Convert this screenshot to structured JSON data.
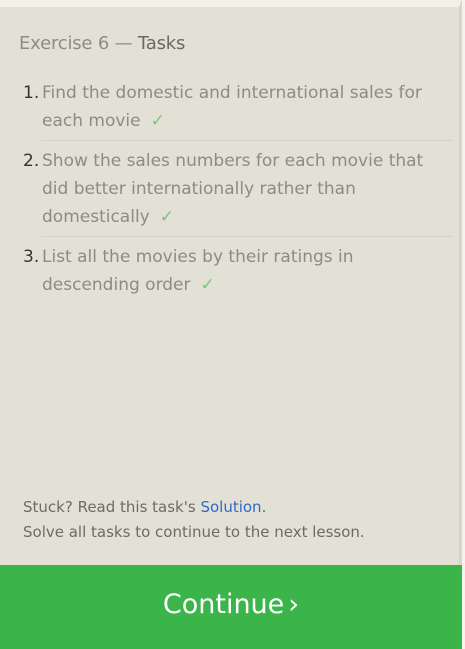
{
  "header": {
    "exercise": "Exercise 6",
    "separator": " — ",
    "section": "Tasks"
  },
  "tasks": [
    {
      "number": "1.",
      "text": "Find the domestic and international sales for each movie",
      "check": "✓"
    },
    {
      "number": "2.",
      "text": "Show the sales numbers for each movie that did better internationally rather than domestically",
      "check": "✓"
    },
    {
      "number": "3.",
      "text": "List all the movies by their ratings in descending order",
      "check": "✓"
    }
  ],
  "help": {
    "stuck_prefix": "Stuck? Read this task's ",
    "solution_link": "Solution",
    "stuck_suffix": ".",
    "instruction": "Solve all tasks to continue to the next lesson."
  },
  "continue_button": {
    "label": "Continue",
    "chevron": "›"
  },
  "colors": {
    "panel_bg": "#e3e0d6",
    "check_green": "#76c777",
    "link_blue": "#2f69c8",
    "button_green": "#3bb54a"
  }
}
